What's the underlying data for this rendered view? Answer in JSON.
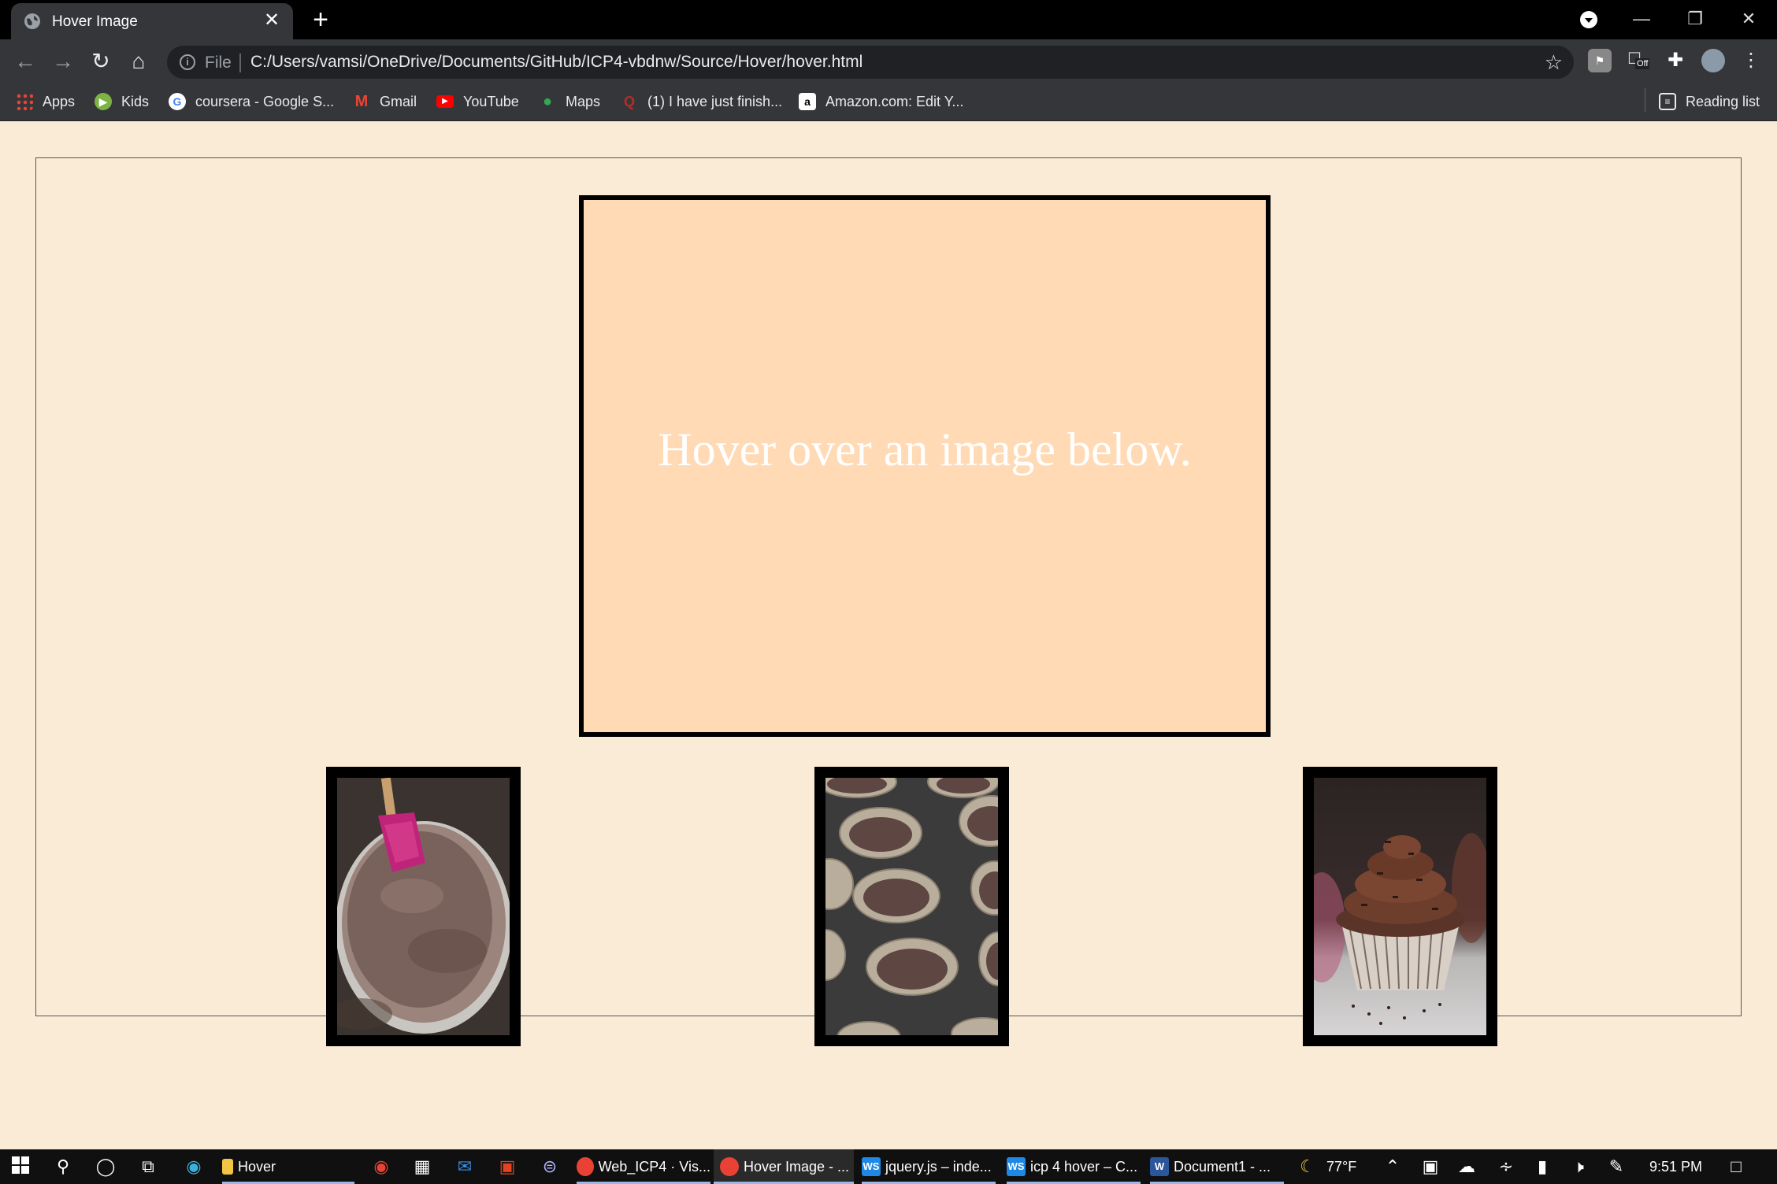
{
  "browser": {
    "tab_title": "Hover Image",
    "tab_close": "✕",
    "new_tab": "+",
    "url_scheme": "File",
    "url": "C:/Users/vamsi/OneDrive/Documents/GitHub/ICP4-vbdnw/Source/Hover/hover.html",
    "extension_badge": "Off",
    "bookmarks": [
      {
        "label": "Apps"
      },
      {
        "label": "Kids"
      },
      {
        "label": "coursera - Google S..."
      },
      {
        "label": "Gmail"
      },
      {
        "label": "YouTube"
      },
      {
        "label": "Maps"
      },
      {
        "label": "(1) I have just finish..."
      },
      {
        "label": "Amazon.com: Edit Y..."
      }
    ],
    "reading_list": "Reading list"
  },
  "page": {
    "hover_message": "Hover over an image below.",
    "thumbnails": [
      {
        "name": "chocolate-batter-bowl"
      },
      {
        "name": "cupcake-tin-batter"
      },
      {
        "name": "frosted-chocolate-cupcake"
      }
    ]
  },
  "taskbar": {
    "items": [
      {
        "label": "Hover"
      },
      {
        "label": "Web_ICP4 · Vis..."
      },
      {
        "label": "Hover Image - ..."
      },
      {
        "label": "jquery.js – inde..."
      },
      {
        "label": "icp 4 hover – C..."
      },
      {
        "label": "Document1 - ..."
      }
    ],
    "weather": "77°F",
    "time": "9:51 PM"
  },
  "colors": {
    "page_bg": "#faebd7",
    "hover_box_bg": "#ffdab4",
    "chrome_dark": "#35363a"
  }
}
